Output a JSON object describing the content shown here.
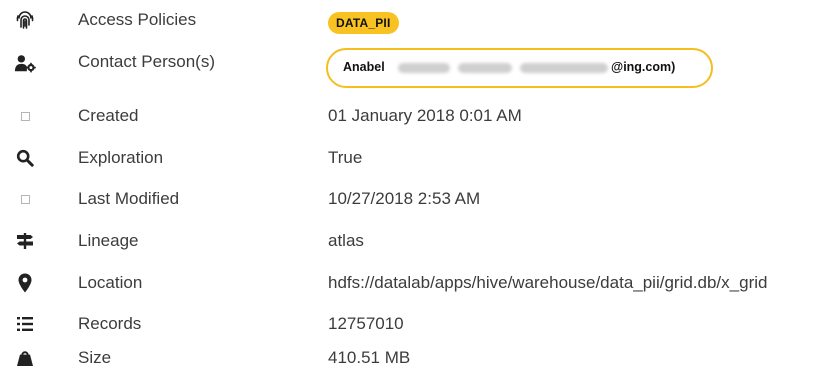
{
  "properties": [
    {
      "icon": "fingerprint-icon",
      "label": "Access Policies",
      "badge": "DATA_PII"
    },
    {
      "icon": "user-gear-icon",
      "label": "Contact Person(s)",
      "contact_first": "Anabel",
      "contact_domain": "@ing.com)"
    },
    {
      "icon": "missing-glyph-icon",
      "label": "Created",
      "value": "01 January 2018 0:01 AM"
    },
    {
      "icon": "search-icon",
      "label": "Exploration",
      "value": "True"
    },
    {
      "icon": "missing-glyph-icon",
      "label": "Last Modified",
      "value": "10/27/2018 2:53 AM"
    },
    {
      "icon": "signpost-icon",
      "label": "Lineage",
      "value": "atlas"
    },
    {
      "icon": "map-marker-icon",
      "label": "Location",
      "value": "hdfs://datalab/apps/hive/warehouse/data_pii/grid.db/x_grid"
    },
    {
      "icon": "list-icon",
      "label": "Records",
      "value": "12757010"
    },
    {
      "icon": "weight-icon",
      "label": "Size",
      "value": "410.51 MB"
    }
  ],
  "colors": {
    "badge_bg": "#f8c322",
    "pill_border": "#f5be1f",
    "text": "#3c3c3c",
    "icon": "#222222"
  }
}
